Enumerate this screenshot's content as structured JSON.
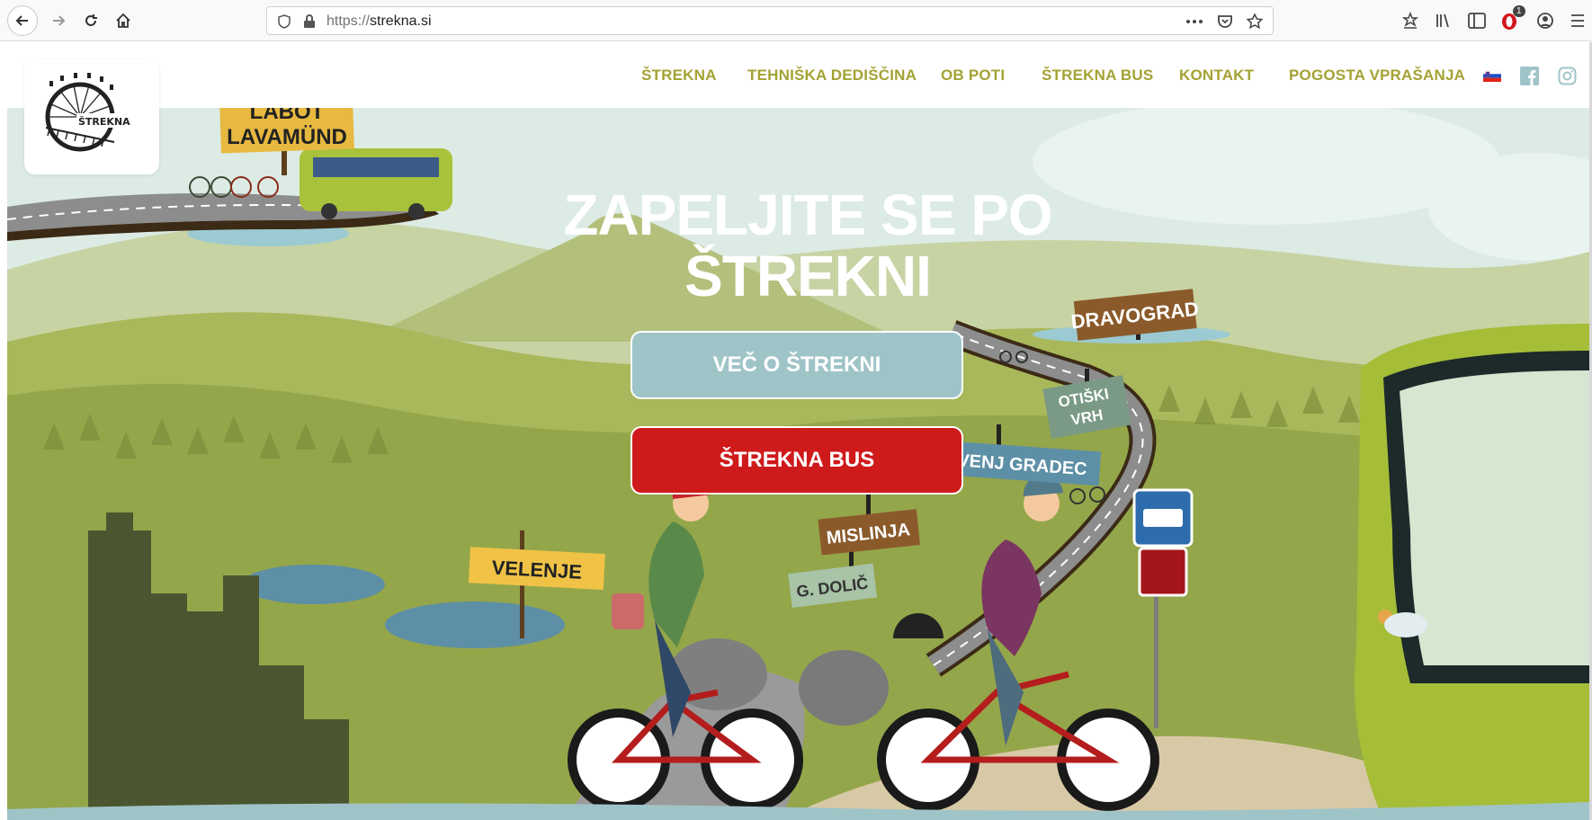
{
  "browser": {
    "url_protocol": "https://",
    "url_host": "strekna.si",
    "notification_count": "1"
  },
  "nav": {
    "items": [
      {
        "label": "ŠTREKNA"
      },
      {
        "label": "TEHNIŠKA DEDIŠČINA"
      },
      {
        "label": "OB POTI"
      },
      {
        "label": "ŠTREKNA BUS"
      },
      {
        "label": "KONTAKT"
      },
      {
        "label": "POGOSTA VPRAŠANJA"
      }
    ]
  },
  "logo": {
    "text": "ŠTREKNA"
  },
  "hero": {
    "title_line1": "ZAPELJITE SE PO",
    "title_line2": "ŠTREKNI",
    "btn_more": "VEČ O ŠTREKNI",
    "btn_bus": "ŠTREKNA BUS"
  },
  "signs": {
    "labot": "LABOT",
    "lavamund": "LAVAMÜND",
    "dravograd": "DRAVOGRAD",
    "otiski": "OTIŠKI",
    "vrh": "VRH",
    "slovenj_gradec": "SLOVENJ GRADEC",
    "mislinja": "MISLINJA",
    "g_dolic": "G. DOLIČ",
    "velenje": "VELENJE"
  },
  "colors": {
    "nav_text": "#a4a233",
    "btn_more_bg": "#9fc4c8",
    "btn_bus_bg": "#cf1a1b",
    "sky": "#dcebe4",
    "grass": "#a7b454"
  }
}
